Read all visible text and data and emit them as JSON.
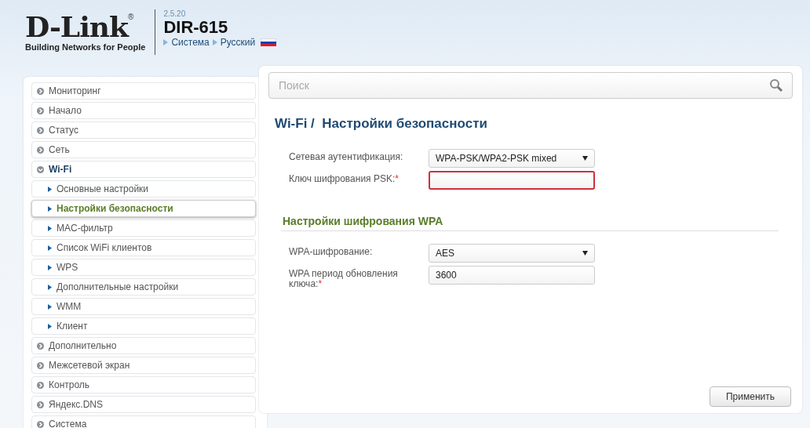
{
  "header": {
    "logo": "D-Link",
    "registered": "®",
    "tagline": "Building Networks for People",
    "version": "2.5.20",
    "model": "DIR-615",
    "breadcrumbs": [
      {
        "label": "Система"
      },
      {
        "label": "Русский"
      }
    ]
  },
  "sidebar": {
    "items": [
      {
        "label": "Мониторинг",
        "kind": "section",
        "selected": false,
        "expanded": false
      },
      {
        "label": "Начало",
        "kind": "section",
        "selected": false,
        "expanded": false
      },
      {
        "label": "Статус",
        "kind": "section",
        "selected": false,
        "expanded": false
      },
      {
        "label": "Сеть",
        "kind": "section",
        "selected": false,
        "expanded": false
      },
      {
        "label": "Wi-Fi",
        "kind": "section",
        "selected": false,
        "expanded": true
      },
      {
        "label": "Основные настройки",
        "kind": "sub",
        "selected": false
      },
      {
        "label": "Настройки безопасности",
        "kind": "sub",
        "selected": true
      },
      {
        "label": "MAC-фильтр",
        "kind": "sub",
        "selected": false
      },
      {
        "label": "Список WiFi клиентов",
        "kind": "sub",
        "selected": false
      },
      {
        "label": "WPS",
        "kind": "sub",
        "selected": false
      },
      {
        "label": "Дополнительные настройки",
        "kind": "sub",
        "selected": false
      },
      {
        "label": "WMM",
        "kind": "sub",
        "selected": false
      },
      {
        "label": "Клиент",
        "kind": "sub",
        "selected": false
      },
      {
        "label": "Дополнительно",
        "kind": "section",
        "selected": false,
        "expanded": false
      },
      {
        "label": "Межсетевой экран",
        "kind": "section",
        "selected": false,
        "expanded": false
      },
      {
        "label": "Контроль",
        "kind": "section",
        "selected": false,
        "expanded": false
      },
      {
        "label": "Яндекс.DNS",
        "kind": "section",
        "selected": false,
        "expanded": false
      },
      {
        "label": "Система",
        "kind": "section",
        "selected": false,
        "expanded": false
      }
    ]
  },
  "search": {
    "placeholder": "Поиск"
  },
  "page": {
    "section": "Wi-Fi /",
    "title": "Настройки безопасности"
  },
  "fields": [
    {
      "label": "Сетевая аутентификация:",
      "kind": "select",
      "value": "WPA-PSK/WPA2-PSK mixed",
      "error": false
    },
    {
      "label": "Ключ шифрования PSK:",
      "kind": "input",
      "required_mark": "*",
      "error": true
    }
  ],
  "wpa": {
    "title": "Настройки шифрования WPA",
    "fields": [
      {
        "label": "WPA-шифрование:",
        "kind": "select",
        "value": "AES",
        "error": false
      },
      {
        "label": "WPA период обновления ключа:",
        "kind": "input",
        "value": "3600",
        "required_mark": "*",
        "error": false
      }
    ]
  },
  "apply_button": "Применить"
}
